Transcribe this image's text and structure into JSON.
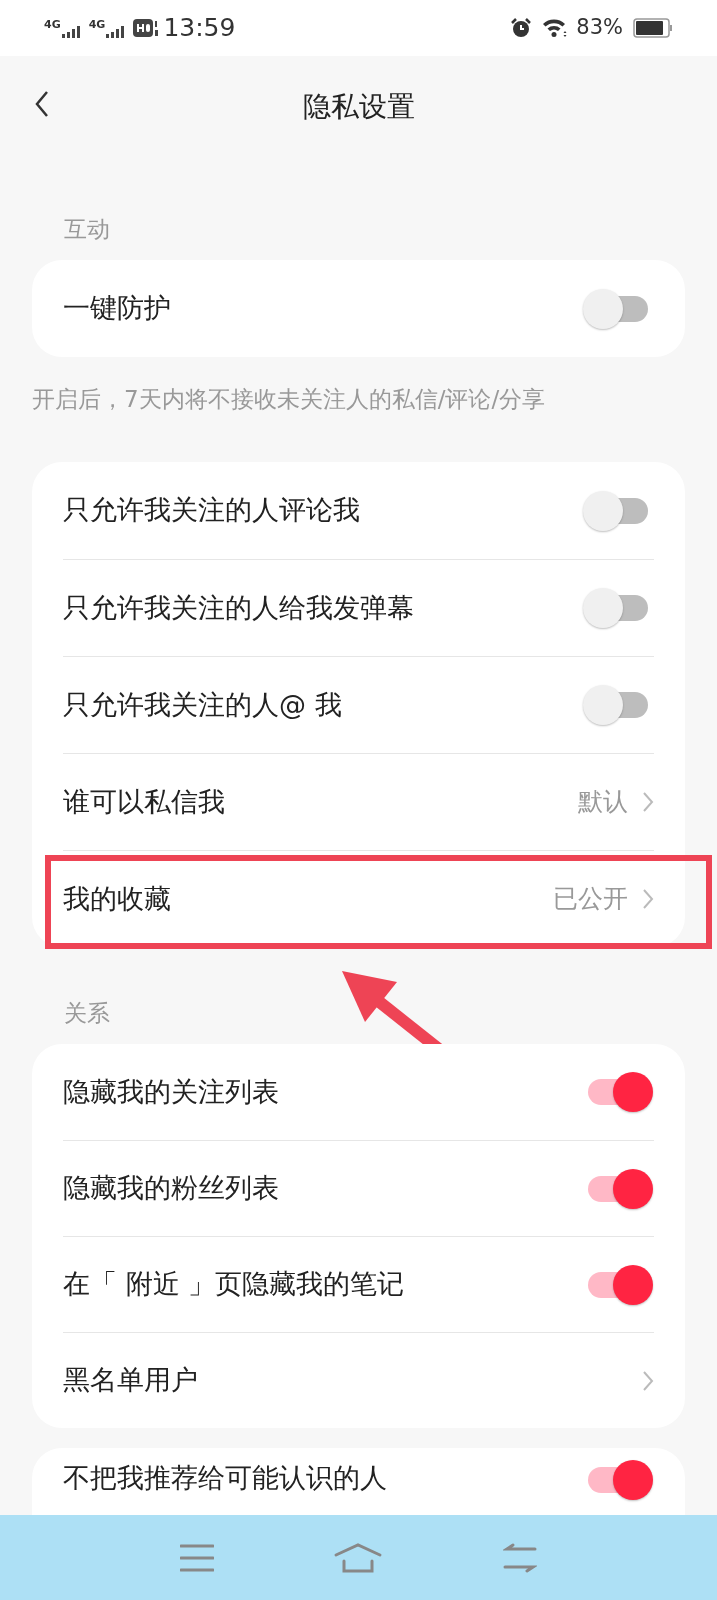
{
  "status_bar": {
    "network_1": "4G",
    "network_2": "4G",
    "time": "13:59",
    "battery": "83%"
  },
  "header": {
    "title": "隐私设置"
  },
  "sections": [
    {
      "label": "互动",
      "cards": [
        {
          "rows": [
            {
              "kind": "toggle",
              "label": "一键防护",
              "on": false
            }
          ],
          "note": "开启后，7天内将不接收未关注人的私信/评论/分享"
        },
        {
          "rows": [
            {
              "kind": "toggle",
              "label": "只允许我关注的人评论我",
              "on": false
            },
            {
              "kind": "toggle",
              "label": "只允许我关注的人给我发弹幕",
              "on": false
            },
            {
              "kind": "toggle",
              "label": "只允许我关注的人@ 我",
              "on": false
            },
            {
              "kind": "link",
              "label": "谁可以私信我",
              "value": "默认",
              "highlighted": false
            },
            {
              "kind": "link",
              "label": "我的收藏",
              "value": "已公开",
              "highlighted": true
            }
          ]
        }
      ]
    },
    {
      "label": "关系",
      "cards": [
        {
          "rows": [
            {
              "kind": "toggle",
              "label": "隐藏我的关注列表",
              "on": true
            },
            {
              "kind": "toggle",
              "label": "隐藏我的粉丝列表",
              "on": true
            },
            {
              "kind": "toggle",
              "label": "在「 附近 」页隐藏我的笔记",
              "on": true
            },
            {
              "kind": "link",
              "label": "黑名单用户",
              "highlighted": false
            }
          ]
        }
      ]
    },
    {
      "cards": [
        {
          "rows": [
            {
              "kind": "toggle",
              "label": "不把我推荐给可能认识的人",
              "on": true
            }
          ]
        }
      ]
    }
  ]
}
